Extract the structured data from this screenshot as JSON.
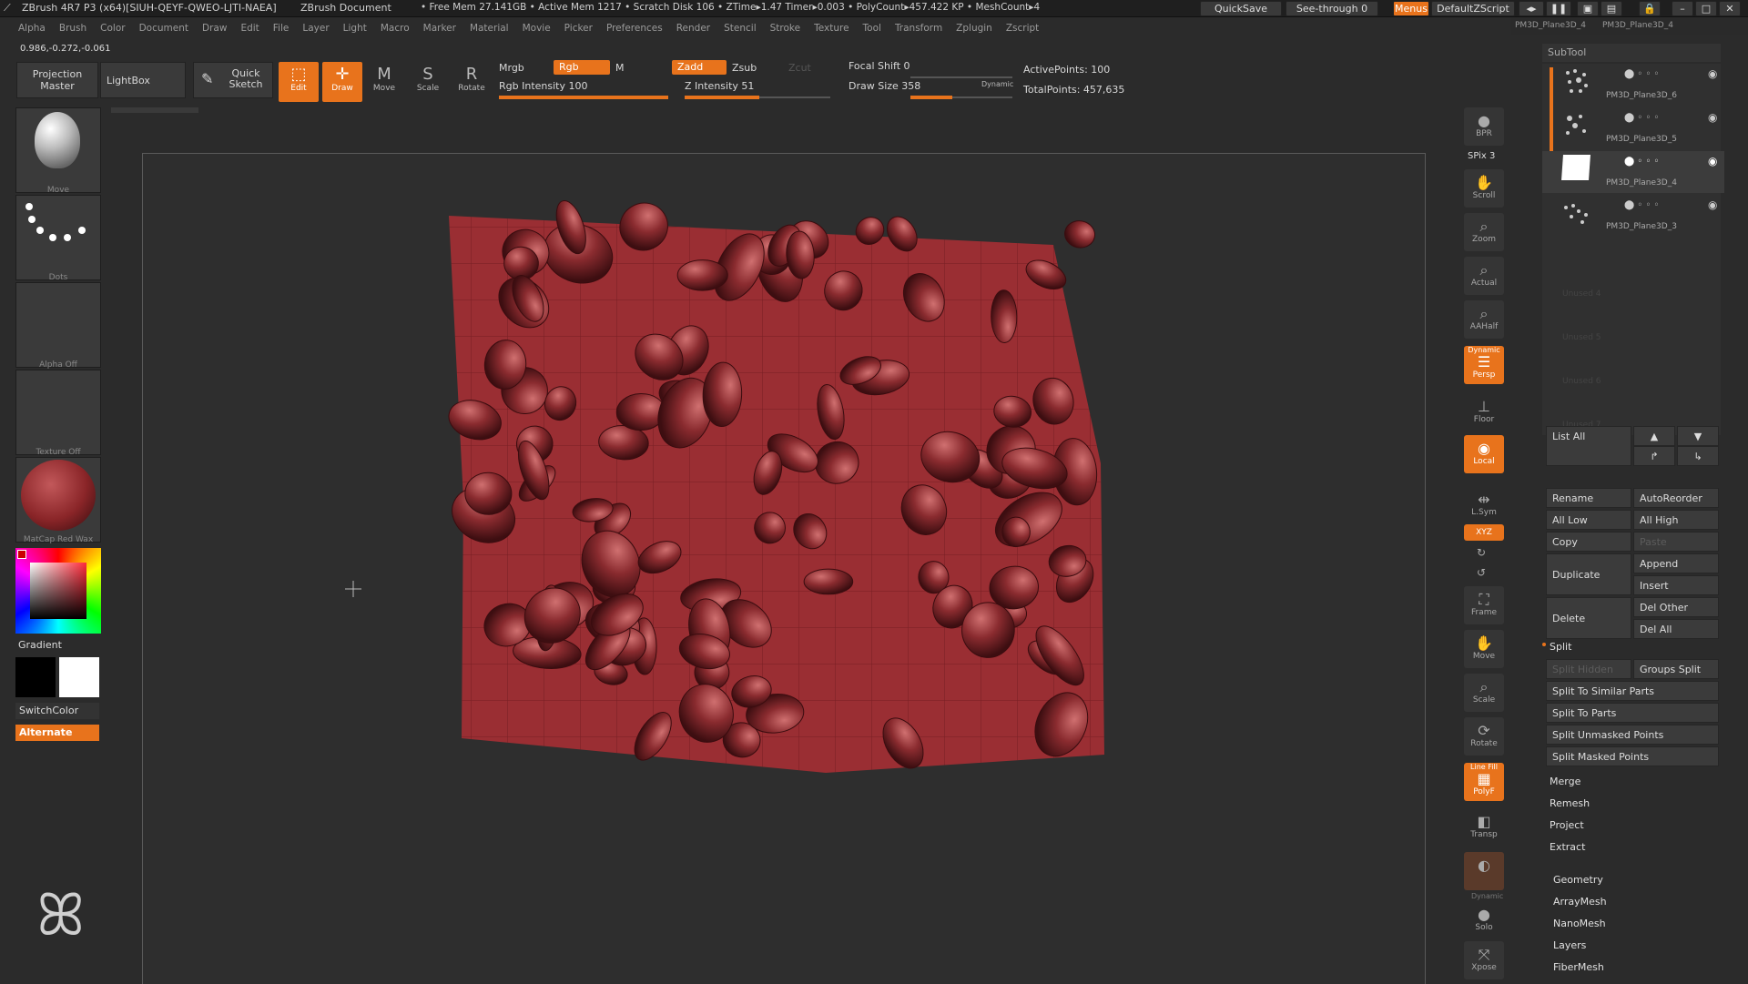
{
  "titlebar": {
    "app": "ZBrush 4R7 P3 (x64)[SIUH-QEYF-QWEO-LJTI-NAEA]",
    "doc": "ZBrush Document",
    "stats": "• Free Mem 27.141GB • Active Mem 1217 • Scratch Disk 106 • ZTime▸1.47 Timer▸0.003 • PolyCount▸457.422 KP • MeshCount▸4",
    "quicksave": "QuickSave",
    "seethrough": "See-through  0",
    "menus": "Menus",
    "script": "DefaultZScript"
  },
  "subtool_tabs": [
    "PM3D_Plane3D_4",
    "PM3D_Plane3D_4"
  ],
  "menus": [
    "Alpha",
    "Brush",
    "Color",
    "Document",
    "Draw",
    "Edit",
    "File",
    "Layer",
    "Light",
    "Macro",
    "Marker",
    "Material",
    "Movie",
    "Picker",
    "Preferences",
    "Render",
    "Stencil",
    "Stroke",
    "Texture",
    "Tool",
    "Transform",
    "Zplugin",
    "Zscript"
  ],
  "coords": "0.986,-0.272,-0.061",
  "toolbar": {
    "projection_master": "Projection Master",
    "lightbox": "LightBox",
    "quick_sketch": "Quick Sketch",
    "edit": "Edit",
    "draw": "Draw",
    "move": "Move",
    "scale": "Scale",
    "rotate": "Rotate",
    "mrgb": "Mrgb",
    "rgb": "Rgb",
    "m": "M",
    "rgb_intensity": "Rgb Intensity 100",
    "rgb_intensity_value": 100,
    "zadd": "Zadd",
    "zsub": "Zsub",
    "zcut": "Zcut",
    "z_intensity": "Z Intensity 51",
    "z_intensity_value": 51,
    "focal_shift": "Focal Shift 0",
    "draw_size": "Draw Size 358",
    "dynamic": "Dynamic",
    "active_points": "ActivePoints: 100",
    "total_points": "TotalPoints: 457,635"
  },
  "left": {
    "brush": "Move",
    "stroke": "Dots",
    "alpha": "Alpha Off",
    "texture": "Texture Off",
    "material": "MatCap Red Wax",
    "gradient": "Gradient",
    "switchcolor": "SwitchColor",
    "alternate": "Alternate"
  },
  "right_tools": {
    "bpr": "BPR",
    "spix": "SPix 3",
    "scroll": "Scroll",
    "zoom": "Zoom",
    "actual": "Actual",
    "aahalf": "AAHalf",
    "dynamic": "Dynamic",
    "persp": "Persp",
    "floor": "Floor",
    "local": "Local",
    "lsym": "L.Sym",
    "xyz": "XYZ",
    "frame": "Frame",
    "move": "Move",
    "scale": "Scale",
    "rotate": "Rotate",
    "linefill": "Line Fill",
    "polyf": "PolyF",
    "transp": "Transp",
    "dynamic2": "Dynamic",
    "solo": "Solo",
    "xpose": "Xpose"
  },
  "subtool": {
    "title": "SubTool",
    "items": [
      "PM3D_Plane3D_6",
      "PM3D_Plane3D_5",
      "PM3D_Plane3D_4",
      "PM3D_Plane3D_3"
    ],
    "unused": [
      "Unused 4",
      "Unused 5",
      "Unused 6",
      "Unused 7"
    ],
    "list_all": "List All",
    "rename": "Rename",
    "autoreorder": "AutoReorder",
    "all_low": "All Low",
    "all_high": "All High",
    "copy": "Copy",
    "paste": "Paste",
    "duplicate": "Duplicate",
    "append": "Append",
    "insert": "Insert",
    "delete": "Delete",
    "del_other": "Del Other",
    "del_all": "Del All",
    "split": "Split",
    "split_hidden": "Split Hidden",
    "groups_split": "Groups Split",
    "split_similar": "Split To Similar Parts",
    "split_parts": "Split To Parts",
    "split_unmasked": "Split Unmasked Points",
    "split_masked": "Split Masked Points",
    "merge": "Merge",
    "remesh": "Remesh",
    "project": "Project",
    "extract": "Extract",
    "sections": [
      "Geometry",
      "ArrayMesh",
      "NanoMesh",
      "Layers",
      "FiberMesh"
    ]
  },
  "colors": {
    "accent": "#e8731c",
    "mesh": "#9a2e33",
    "canvas": "#2e2e2e"
  }
}
